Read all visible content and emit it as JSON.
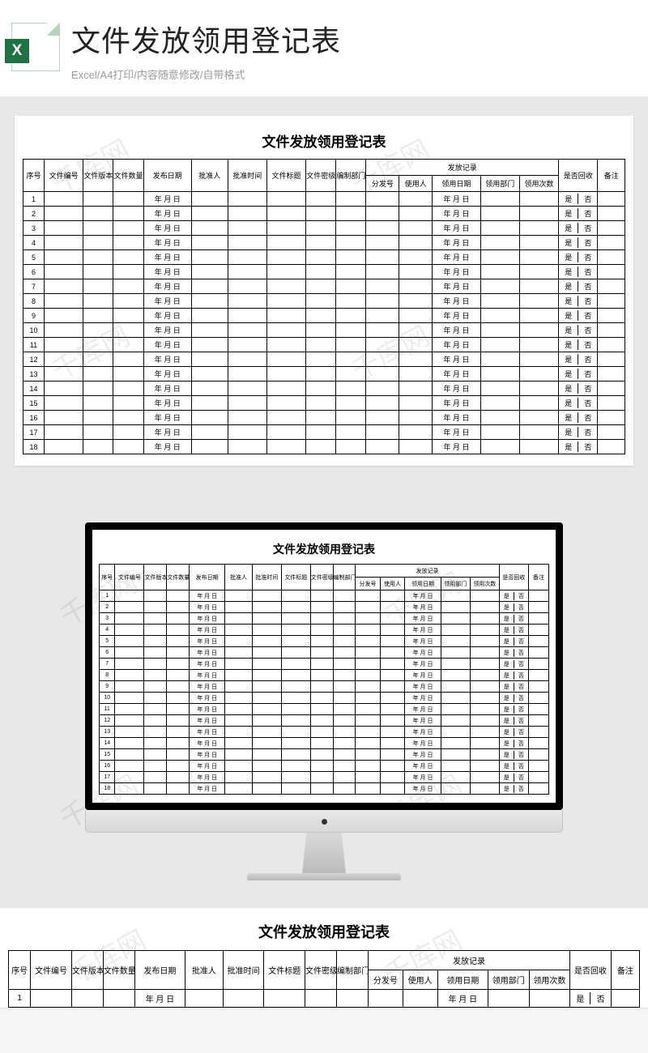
{
  "header": {
    "excel_icon_letter": "X",
    "title": "文件发放领用登记表",
    "subtitle": "Excel/A4打印/内容随意修改/自带格式"
  },
  "watermark_text": "千库网",
  "table": {
    "title": "文件发放领用登记表",
    "headers": {
      "seq": "序号",
      "doc_no": "文件编号",
      "version": "文件版本",
      "qty": "文件数量",
      "issue_date": "发布日期",
      "approver": "批准人",
      "approve_time": "批准时间",
      "title": "文件标题",
      "secret": "文件密级",
      "dept": "编制部门",
      "distribution_group": "发放记录",
      "dist_no": "分发号",
      "user": "使用人",
      "receive_date": "领用日期",
      "receive_dept": "领用部门",
      "receive_times": "领用次数",
      "recycled": "是否回收",
      "remark": "备注"
    },
    "date_placeholder": "年 月 日",
    "yes": "是",
    "no": "否",
    "row_count": 18
  }
}
